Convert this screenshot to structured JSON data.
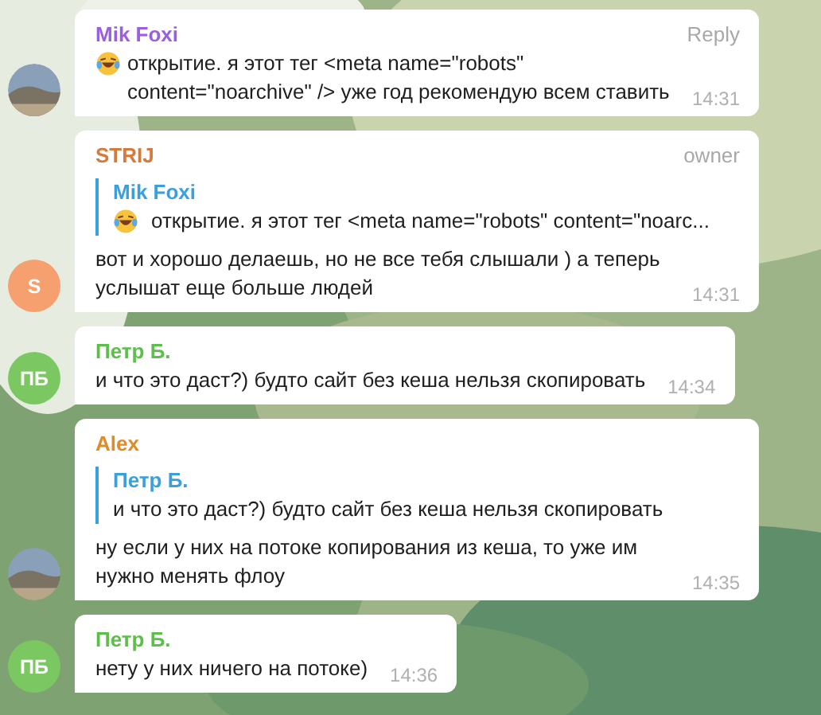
{
  "messages": [
    {
      "sender": "Mik Foxi",
      "color": "#9a5ee0",
      "badge": "Reply",
      "has_emoji": true,
      "text": "открытие. я этот тег <meta name=\"robots\" content=\"noarchive\" /> уже год рекомендую всем ставить",
      "time": "14:31"
    },
    {
      "sender": "STRIJ",
      "color": "#d67a3c",
      "badge": "owner",
      "avatar": {
        "kind": "initials",
        "initials": "S",
        "color": "#f5a06e"
      },
      "reply": {
        "sender": "Mik Foxi",
        "has_emoji": true,
        "text": "открытие. я этот тег <meta name=\"robots\" content=\"noarc..."
      },
      "has_emoji": false,
      "text": "вот и хорошо делаешь, но не все тебя слышали ) а теперь услышат еще больше людей",
      "time": "14:31"
    },
    {
      "sender": "Петр Б.",
      "color": "#5cbf4a",
      "avatar": {
        "kind": "initials",
        "initials": "ПБ",
        "color": "#7bc862"
      },
      "has_emoji": false,
      "text": "и что это даст?) будто сайт без кеша нельзя скопировать",
      "time": "14:34"
    },
    {
      "sender": "Alex",
      "color": "#e08a2a",
      "reply": {
        "sender": "Петр Б.",
        "has_emoji": false,
        "text": "и что это даст?) будто сайт без кеша нельзя скопировать"
      },
      "has_emoji": false,
      "text": "ну если у них на потоке копирования из кеша, то уже им нужно менять флоу",
      "time": "14:35"
    },
    {
      "sender": "Петр Б.",
      "color": "#5cbf4a",
      "avatar": {
        "kind": "initials",
        "initials": "ПБ",
        "color": "#7bc862"
      },
      "has_emoji": false,
      "text": "нету у них ничего на потоке)",
      "time": "14:36"
    }
  ]
}
